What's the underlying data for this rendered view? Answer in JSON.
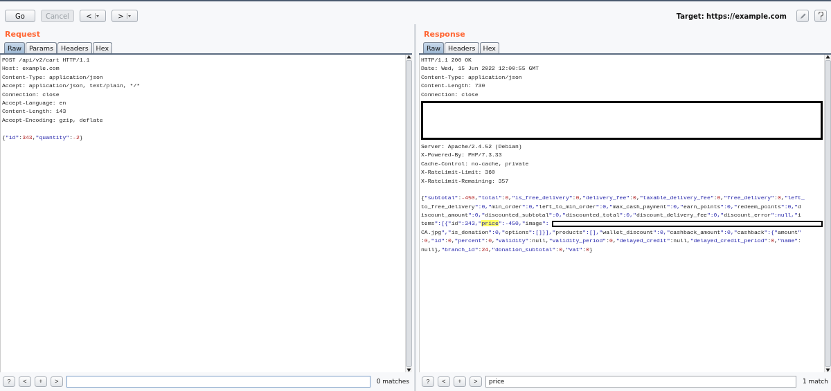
{
  "toolbar": {
    "buttons": [
      {
        "label": "Go",
        "disabled": false
      },
      {
        "label": "Cancel",
        "disabled": true
      }
    ],
    "history": [
      {
        "label": "<"
      },
      {
        "label": ">"
      }
    ],
    "target": "Target: https://example.com"
  },
  "panels": [
    {
      "title": "Request",
      "tabs": [
        {
          "label": "Raw",
          "selected": true
        },
        {
          "label": "Params",
          "selected": false
        },
        {
          "label": "Headers",
          "selected": false
        },
        {
          "label": "Hex",
          "selected": false
        }
      ],
      "lines": [
        {
          "kind": "text",
          "text": "POST /api/v2/cart HTTP/1.1"
        },
        {
          "kind": "text",
          "text": "Host: example.com"
        },
        {
          "kind": "text",
          "text": "Content-Type: application/json"
        },
        {
          "kind": "text",
          "text": "Accept: application/json, text/plain, */*"
        },
        {
          "kind": "text",
          "text": "Connection: close"
        },
        {
          "kind": "text",
          "text": "Accept-Language: en"
        },
        {
          "kind": "text",
          "text": "Content-Length: 143"
        },
        {
          "kind": "text",
          "text": "Accept-Encoding: gzip, deflate"
        },
        {
          "kind": "blank"
        },
        {
          "kind": "code",
          "segments": [
            {
              "text": "{\"id\":343,\"quantity\":-2}",
              "highlighted": false
            }
          ]
        }
      ],
      "search": {
        "buttons": [
          "?",
          "<",
          "+",
          ">"
        ],
        "focused": true,
        "matches": "0 matches"
      }
    },
    {
      "title": "Response",
      "tabs": [
        {
          "label": "Raw",
          "selected": true
        },
        {
          "label": "Headers",
          "selected": false
        },
        {
          "label": "Hex",
          "selected": false
        }
      ],
      "lines": [
        {
          "kind": "text",
          "text": "HTTP/1.1 200 OK"
        },
        {
          "kind": "text",
          "text": "Date: Wed, 15 Jun 2022 12:00:55 GMT"
        },
        {
          "kind": "text",
          "text": "Content-Type: application/json"
        },
        {
          "kind": "text",
          "text": "Content-Length: 730"
        },
        {
          "kind": "text",
          "text": "Connection: close"
        },
        {
          "kind": "redaction"
        },
        {
          "kind": "text",
          "text": "Server: Apache/2.4.52 (Debian)"
        },
        {
          "kind": "text",
          "text": "X-Powered-By: PHP/7.3.33"
        },
        {
          "kind": "text",
          "text": "Cache-Control: no-cache, private"
        },
        {
          "kind": "text",
          "text": "X-RateLimit-Limit: 360"
        },
        {
          "kind": "text",
          "text": "X-RateLimit-Remaining: 357"
        },
        {
          "kind": "blank"
        },
        {
          "kind": "code",
          "segments": [
            {
              "text": "{\"subtotal\":-450,\"total\":0,\"is_free_delivery\":0,\"delivery_fee\":0,\"taxable_delivery_fee\":0,\"free_delivery\":0,\"left_",
              "highlighted": false
            }
          ]
        },
        {
          "kind": "code",
          "segments": [
            {
              "text": "to_free_delivery\":0,\"min_order\":0,\"left_to_min_order\":0,\"max_cash_payment\":0,\"earn_points\":0,\"redeem_points\":0,\"d",
              "highlighted": false
            }
          ]
        },
        {
          "kind": "code",
          "segments": [
            {
              "text": "iscount_amount\":0,\"discounted_subtotal\":0,\"discounted_total\":0,\"discount_delivery_fee\":0,\"discount_error\":null,\"i",
              "highlighted": false
            }
          ]
        },
        {
          "kind": "code",
          "redacted_tail": true,
          "segments": [
            {
              "text": "tems\":[{\"id\":343,\"",
              "highlighted": false
            },
            {
              "text": "price",
              "highlighted": true
            },
            {
              "text": "\":-450,\"image\":",
              "highlighted": false
            }
          ]
        },
        {
          "kind": "code",
          "segments": [
            {
              "text": "CA.jpg\",\"is_donation\":0,\"options\":[]}],\"products\":[],\"wallet_discount\":0,\"cashback_amount\":0,\"cashback\":{\"amount\"",
              "highlighted": false
            }
          ]
        },
        {
          "kind": "code",
          "segments": [
            {
              "text": ":0,\"id\":0,\"percent\":0,\"validity\":null,\"validity_period\":0,\"delayed_credit\":null,\"delayed_credit_period\":0,\"name\":",
              "highlighted": false
            }
          ]
        },
        {
          "kind": "code",
          "segments": [
            {
              "text": "null},\"branch_id\":24,\"donation_subtotal\":0,\"vat\":0}",
              "highlighted": false
            }
          ]
        }
      ],
      "search": {
        "buttons": [
          "?",
          "<",
          "+",
          ">"
        ],
        "value": "price",
        "focused": false,
        "matches": "1 match"
      }
    }
  ]
}
